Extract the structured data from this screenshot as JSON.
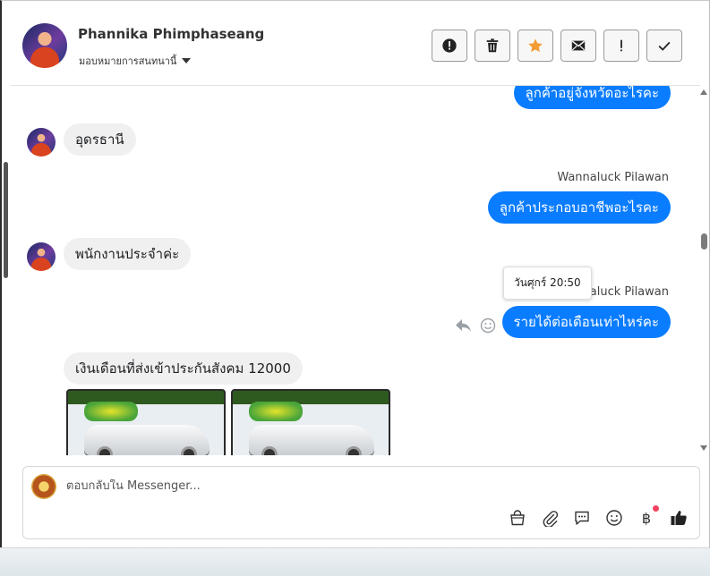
{
  "header": {
    "contact_name": "Phannika Phimphaseang",
    "assign_label": "มอบหมายการสนทนานี้",
    "actions": [
      {
        "name": "report-button",
        "icon": "alert-circle-icon"
      },
      {
        "name": "delete-button",
        "icon": "trash-icon"
      },
      {
        "name": "star-button",
        "icon": "star-icon"
      },
      {
        "name": "mark-unread-button",
        "icon": "envelope-icon"
      },
      {
        "name": "follow-up-button",
        "icon": "exclamation-icon"
      },
      {
        "name": "done-button",
        "icon": "checkmark-icon"
      }
    ]
  },
  "messages": {
    "m1_out": "ลูกค้าอยู่จังหวัดอะไรคะ",
    "m2_in": "อุดรธานี",
    "m3_sender": "Wannaluck Pilawan",
    "m3_out": "ลูกค้าประกอบอาชีพอะไรคะ",
    "m4_in": "พนักงานประจำค่ะ",
    "m5_tooltip": "วันศุกร์ 20:50",
    "m5_sender": "Wannaluck Pilawan",
    "m5_out": "รายได้ต่อเดือนเท่าไหร่คะ",
    "m6_in": "เงินเดือนที่ส่งเข้าประกันสังคม 12000",
    "m7_images": [
      "car-photo-honda-civic",
      "car-photo-toyota-altis"
    ]
  },
  "composer": {
    "placeholder": "ตอบกลับใน Messenger...",
    "baht_symbol": "฿"
  },
  "colors": {
    "outgoing_bubble": "#0a7cff",
    "incoming_bubble": "#f0f0f0",
    "star": "#f39c33",
    "notification_dot": "#f3425f"
  }
}
